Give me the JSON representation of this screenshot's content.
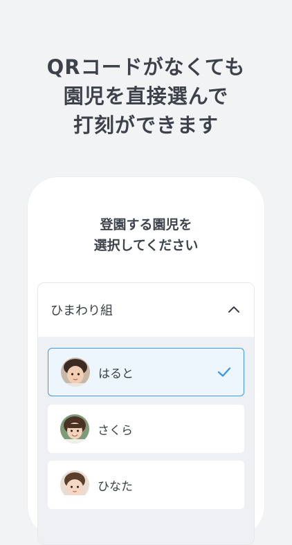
{
  "headline": {
    "line1": "QRコードがなくても",
    "line2": "園児を直接選んで",
    "line3": "打刻ができます"
  },
  "screen": {
    "prompt_line1": "登園する園児を",
    "prompt_line2": "選択してください",
    "group": {
      "name": "ひまわり組",
      "expanded": true,
      "children": [
        {
          "name": "はると",
          "selected": true
        },
        {
          "name": "さくら",
          "selected": false
        },
        {
          "name": "ひなた",
          "selected": false
        }
      ]
    }
  },
  "colors": {
    "accent": "#3b9ae6",
    "selected_bg": "#eef6fd",
    "page_bg": "#f2f3f5"
  }
}
